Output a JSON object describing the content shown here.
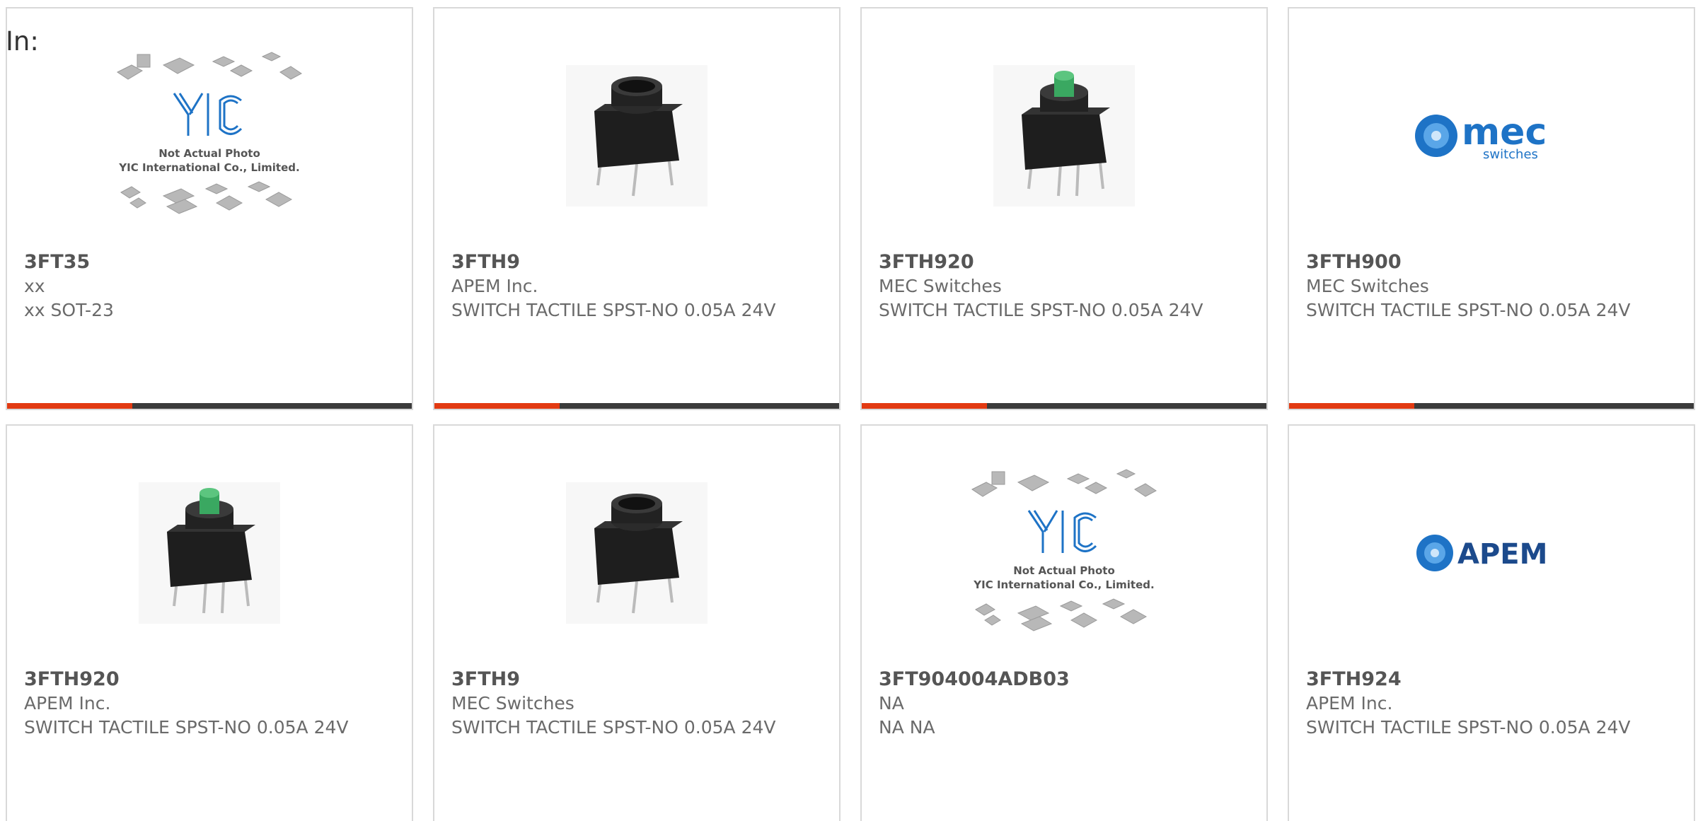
{
  "header": {
    "label": "In:"
  },
  "theme": {
    "accent": "#e23a12",
    "bar": "#3b3b3b",
    "border": "#d9d9d9",
    "mec_blue": "#1e73c6",
    "apem_blue": "#1c4a8c"
  },
  "progress_fraction": 0.31,
  "placeholder_logo": {
    "line1": "Not Actual Photo",
    "line2": "YIC International Co., Limited.",
    "mark": "YIC"
  },
  "logo_mec": {
    "word": "mec",
    "sub": "switches"
  },
  "logo_apem": {
    "word": "APEM"
  },
  "products": [
    {
      "part": "3FT35",
      "maker": "xx",
      "desc": "xx SOT-23",
      "image": "placeholder-photo"
    },
    {
      "part": "3FTH9",
      "maker": "APEM Inc.",
      "desc": "SWITCH TACTILE SPST-NO 0.05A 24V",
      "image": "tactile-switch-black"
    },
    {
      "part": "3FTH920",
      "maker": "MEC Switches",
      "desc": "SWITCH TACTILE SPST-NO 0.05A 24V",
      "image": "tactile-switch-green"
    },
    {
      "part": "3FTH900",
      "maker": "MEC Switches",
      "desc": "SWITCH TACTILE SPST-NO 0.05A 24V",
      "image": "mec-logo"
    },
    {
      "part": "3FTH920",
      "maker": "APEM Inc.",
      "desc": "SWITCH TACTILE SPST-NO 0.05A 24V",
      "image": "tactile-switch-green"
    },
    {
      "part": "3FTH9",
      "maker": "MEC Switches",
      "desc": "SWITCH TACTILE SPST-NO 0.05A 24V",
      "image": "tactile-switch-black"
    },
    {
      "part": "3FT904004ADB03",
      "maker": "NA",
      "desc": "NA NA",
      "image": "placeholder-photo"
    },
    {
      "part": "3FTH924",
      "maker": "APEM Inc.",
      "desc": "SWITCH TACTILE SPST-NO 0.05A 24V",
      "image": "apem-logo"
    }
  ]
}
